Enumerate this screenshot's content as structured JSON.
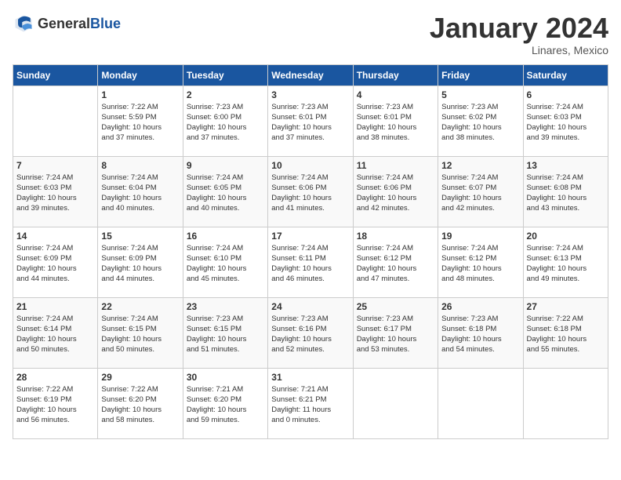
{
  "logo": {
    "general": "General",
    "blue": "Blue"
  },
  "header": {
    "month": "January 2024",
    "location": "Linares, Mexico"
  },
  "days_of_week": [
    "Sunday",
    "Monday",
    "Tuesday",
    "Wednesday",
    "Thursday",
    "Friday",
    "Saturday"
  ],
  "weeks": [
    [
      {
        "day": "",
        "info": ""
      },
      {
        "day": "1",
        "info": "Sunrise: 7:22 AM\nSunset: 5:59 PM\nDaylight: 10 hours\nand 37 minutes."
      },
      {
        "day": "2",
        "info": "Sunrise: 7:23 AM\nSunset: 6:00 PM\nDaylight: 10 hours\nand 37 minutes."
      },
      {
        "day": "3",
        "info": "Sunrise: 7:23 AM\nSunset: 6:01 PM\nDaylight: 10 hours\nand 37 minutes."
      },
      {
        "day": "4",
        "info": "Sunrise: 7:23 AM\nSunset: 6:01 PM\nDaylight: 10 hours\nand 38 minutes."
      },
      {
        "day": "5",
        "info": "Sunrise: 7:23 AM\nSunset: 6:02 PM\nDaylight: 10 hours\nand 38 minutes."
      },
      {
        "day": "6",
        "info": "Sunrise: 7:24 AM\nSunset: 6:03 PM\nDaylight: 10 hours\nand 39 minutes."
      }
    ],
    [
      {
        "day": "7",
        "info": "Sunrise: 7:24 AM\nSunset: 6:03 PM\nDaylight: 10 hours\nand 39 minutes."
      },
      {
        "day": "8",
        "info": "Sunrise: 7:24 AM\nSunset: 6:04 PM\nDaylight: 10 hours\nand 40 minutes."
      },
      {
        "day": "9",
        "info": "Sunrise: 7:24 AM\nSunset: 6:05 PM\nDaylight: 10 hours\nand 40 minutes."
      },
      {
        "day": "10",
        "info": "Sunrise: 7:24 AM\nSunset: 6:06 PM\nDaylight: 10 hours\nand 41 minutes."
      },
      {
        "day": "11",
        "info": "Sunrise: 7:24 AM\nSunset: 6:06 PM\nDaylight: 10 hours\nand 42 minutes."
      },
      {
        "day": "12",
        "info": "Sunrise: 7:24 AM\nSunset: 6:07 PM\nDaylight: 10 hours\nand 42 minutes."
      },
      {
        "day": "13",
        "info": "Sunrise: 7:24 AM\nSunset: 6:08 PM\nDaylight: 10 hours\nand 43 minutes."
      }
    ],
    [
      {
        "day": "14",
        "info": "Sunrise: 7:24 AM\nSunset: 6:09 PM\nDaylight: 10 hours\nand 44 minutes."
      },
      {
        "day": "15",
        "info": "Sunrise: 7:24 AM\nSunset: 6:09 PM\nDaylight: 10 hours\nand 44 minutes."
      },
      {
        "day": "16",
        "info": "Sunrise: 7:24 AM\nSunset: 6:10 PM\nDaylight: 10 hours\nand 45 minutes."
      },
      {
        "day": "17",
        "info": "Sunrise: 7:24 AM\nSunset: 6:11 PM\nDaylight: 10 hours\nand 46 minutes."
      },
      {
        "day": "18",
        "info": "Sunrise: 7:24 AM\nSunset: 6:12 PM\nDaylight: 10 hours\nand 47 minutes."
      },
      {
        "day": "19",
        "info": "Sunrise: 7:24 AM\nSunset: 6:12 PM\nDaylight: 10 hours\nand 48 minutes."
      },
      {
        "day": "20",
        "info": "Sunrise: 7:24 AM\nSunset: 6:13 PM\nDaylight: 10 hours\nand 49 minutes."
      }
    ],
    [
      {
        "day": "21",
        "info": "Sunrise: 7:24 AM\nSunset: 6:14 PM\nDaylight: 10 hours\nand 50 minutes."
      },
      {
        "day": "22",
        "info": "Sunrise: 7:24 AM\nSunset: 6:15 PM\nDaylight: 10 hours\nand 50 minutes."
      },
      {
        "day": "23",
        "info": "Sunrise: 7:23 AM\nSunset: 6:15 PM\nDaylight: 10 hours\nand 51 minutes."
      },
      {
        "day": "24",
        "info": "Sunrise: 7:23 AM\nSunset: 6:16 PM\nDaylight: 10 hours\nand 52 minutes."
      },
      {
        "day": "25",
        "info": "Sunrise: 7:23 AM\nSunset: 6:17 PM\nDaylight: 10 hours\nand 53 minutes."
      },
      {
        "day": "26",
        "info": "Sunrise: 7:23 AM\nSunset: 6:18 PM\nDaylight: 10 hours\nand 54 minutes."
      },
      {
        "day": "27",
        "info": "Sunrise: 7:22 AM\nSunset: 6:18 PM\nDaylight: 10 hours\nand 55 minutes."
      }
    ],
    [
      {
        "day": "28",
        "info": "Sunrise: 7:22 AM\nSunset: 6:19 PM\nDaylight: 10 hours\nand 56 minutes."
      },
      {
        "day": "29",
        "info": "Sunrise: 7:22 AM\nSunset: 6:20 PM\nDaylight: 10 hours\nand 58 minutes."
      },
      {
        "day": "30",
        "info": "Sunrise: 7:21 AM\nSunset: 6:20 PM\nDaylight: 10 hours\nand 59 minutes."
      },
      {
        "day": "31",
        "info": "Sunrise: 7:21 AM\nSunset: 6:21 PM\nDaylight: 11 hours\nand 0 minutes."
      },
      {
        "day": "",
        "info": ""
      },
      {
        "day": "",
        "info": ""
      },
      {
        "day": "",
        "info": ""
      }
    ]
  ]
}
